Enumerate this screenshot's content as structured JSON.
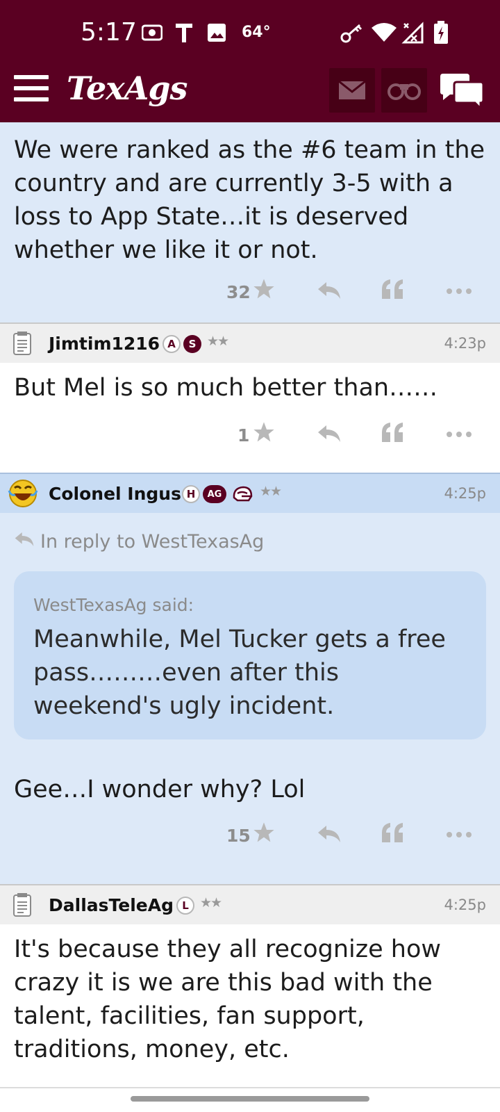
{
  "status_bar": {
    "time": "5:17",
    "temperature": "64°",
    "icons": [
      "camera-icon",
      "t-app-icon",
      "image-icon",
      "key-icon",
      "wifi-icon",
      "no-signal-icon",
      "battery-charging-icon"
    ]
  },
  "header": {
    "logo": "TexAgs",
    "icons": [
      "menu-icon",
      "mail-icon",
      "binoculars-icon",
      "chat-bubbles-icon"
    ],
    "colors": {
      "brand": "#5a0022",
      "button_bg": "#470016"
    }
  },
  "posts": [
    {
      "body": "We were ranked as the #6 team in the country and are currently 3-5 with a loss to App State…it is deserved whether we like it or not.",
      "star_count": "32"
    },
    {
      "username": "Jimtim1216",
      "badges": [
        "A",
        "S"
      ],
      "rank_stars": "★★",
      "time": "4:23p",
      "body": "But Mel is so much better than……",
      "star_count": "1"
    },
    {
      "username": "Colonel Ingus",
      "badges": [
        "H",
        "AG"
      ],
      "rank_stars": "★★",
      "time": "4:25p",
      "reply_to": "In reply to WestTexasAg",
      "quote_author": "WestTexasAg said:",
      "quote_text": "Meanwhile, Mel Tucker gets a free pass………even after this weekend's ugly incident.",
      "body": "Gee…I wonder why? Lol",
      "star_count": "15"
    },
    {
      "username": "DallasTeleAg",
      "badges": [
        "L"
      ],
      "rank_stars": "★★",
      "time": "4:25p",
      "body": "It's because they all recognize how crazy it is we are this bad with the talent, facilities, fan support, traditions, money, etc."
    }
  ]
}
